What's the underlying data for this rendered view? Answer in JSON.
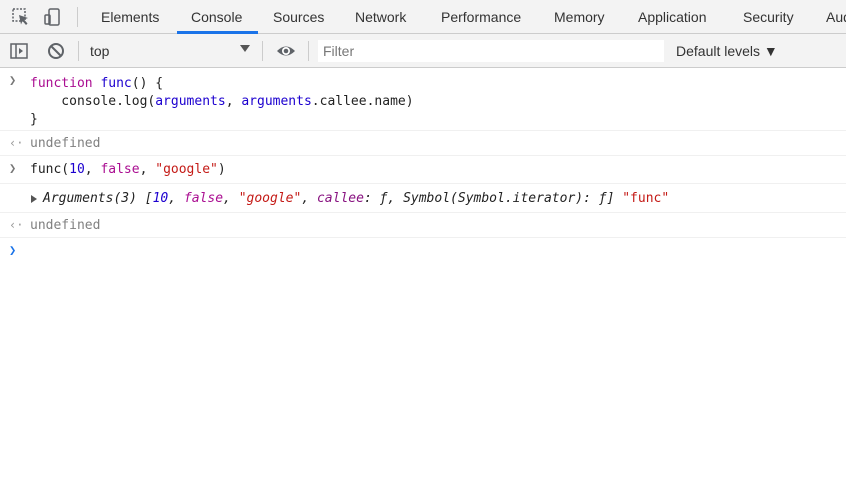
{
  "tabs": [
    {
      "label": "Elements"
    },
    {
      "label": "Console"
    },
    {
      "label": "Sources"
    },
    {
      "label": "Network"
    },
    {
      "label": "Performance"
    },
    {
      "label": "Memory"
    },
    {
      "label": "Application"
    },
    {
      "label": "Security"
    },
    {
      "label": "Aud"
    }
  ],
  "active_tab": "Console",
  "toolbar": {
    "context": "top",
    "filter_placeholder": "Filter",
    "levels": "Default levels ▼"
  },
  "console": {
    "input1": {
      "line1_kw": "function",
      "line1_name": "func",
      "line1_rest": "() {",
      "line2_pre": "    console.log(",
      "line2_args1": "arguments",
      "line2_sep": ", ",
      "line2_args2": "arguments",
      "line2_tail": ".callee.name)",
      "line3": "}"
    },
    "result1": "undefined",
    "input2": {
      "pre": "func(",
      "num": "10",
      "sep1": ", ",
      "bool": "false",
      "sep2": ", ",
      "str": "\"google\"",
      "close": ")"
    },
    "output": {
      "label": "Arguments(3) [",
      "num": "10",
      "sep1": ", ",
      "bool": "false",
      "sep2": ", ",
      "str": "\"google\"",
      "sep3": ", ",
      "callee_key": "callee",
      "callee_val": ": ƒ, ",
      "sym": "Symbol(Symbol.iterator)",
      "sym_val": ": ƒ]",
      "extra": " \"func\""
    },
    "result2": "undefined"
  },
  "colors": {
    "tab_accent": "#1a73e8",
    "prompt_blue": "#1a73e8",
    "toolbar_bg": "#f3f3f3"
  },
  "icons": [
    "inspect-element-icon",
    "device-toolbar-icon",
    "sidebar-toggle-icon",
    "clear-console-icon",
    "live-expression-eye-icon",
    "prompt-chevron-icon",
    "result-arrow-icon",
    "expand-triangle-icon"
  ]
}
